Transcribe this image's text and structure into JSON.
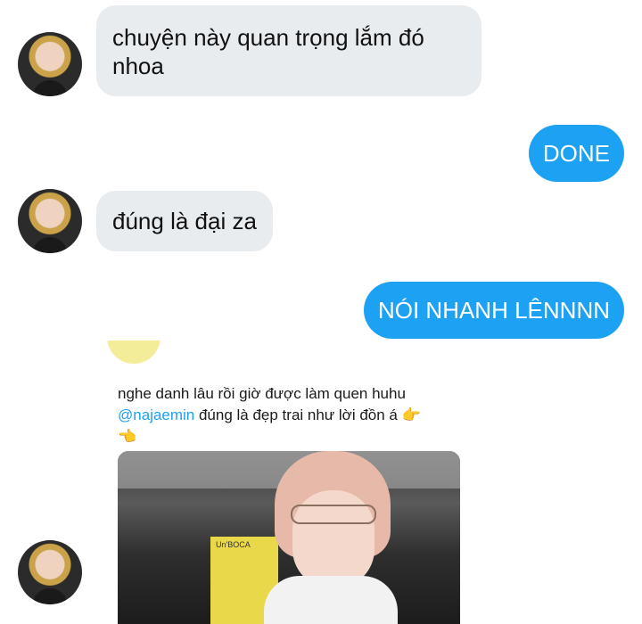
{
  "messages": {
    "m1": {
      "text": "chuyện này quan trọng lắm đó\nnhoa"
    },
    "m2": {
      "text": "DONE"
    },
    "m3": {
      "text": "đúng là đại za"
    },
    "m4": {
      "text": "NÓI NHANH LÊNNNN"
    }
  },
  "tweet": {
    "text_before": "nghe danh lâu rồi giờ được làm quen huhu",
    "mention": "@najaemin",
    "text_after": " đúng là đẹp trai như lời đồn á 👉",
    "text_line3": "👈",
    "poster_text": "Un'BOCA"
  },
  "colors": {
    "outgoing_bubble": "#1da1f2",
    "incoming_bubble": "#e9ecef",
    "mention": "#1da1f2"
  },
  "icons": {
    "avatar": "profile-photo",
    "tweet_avatar": "profile-photo"
  }
}
